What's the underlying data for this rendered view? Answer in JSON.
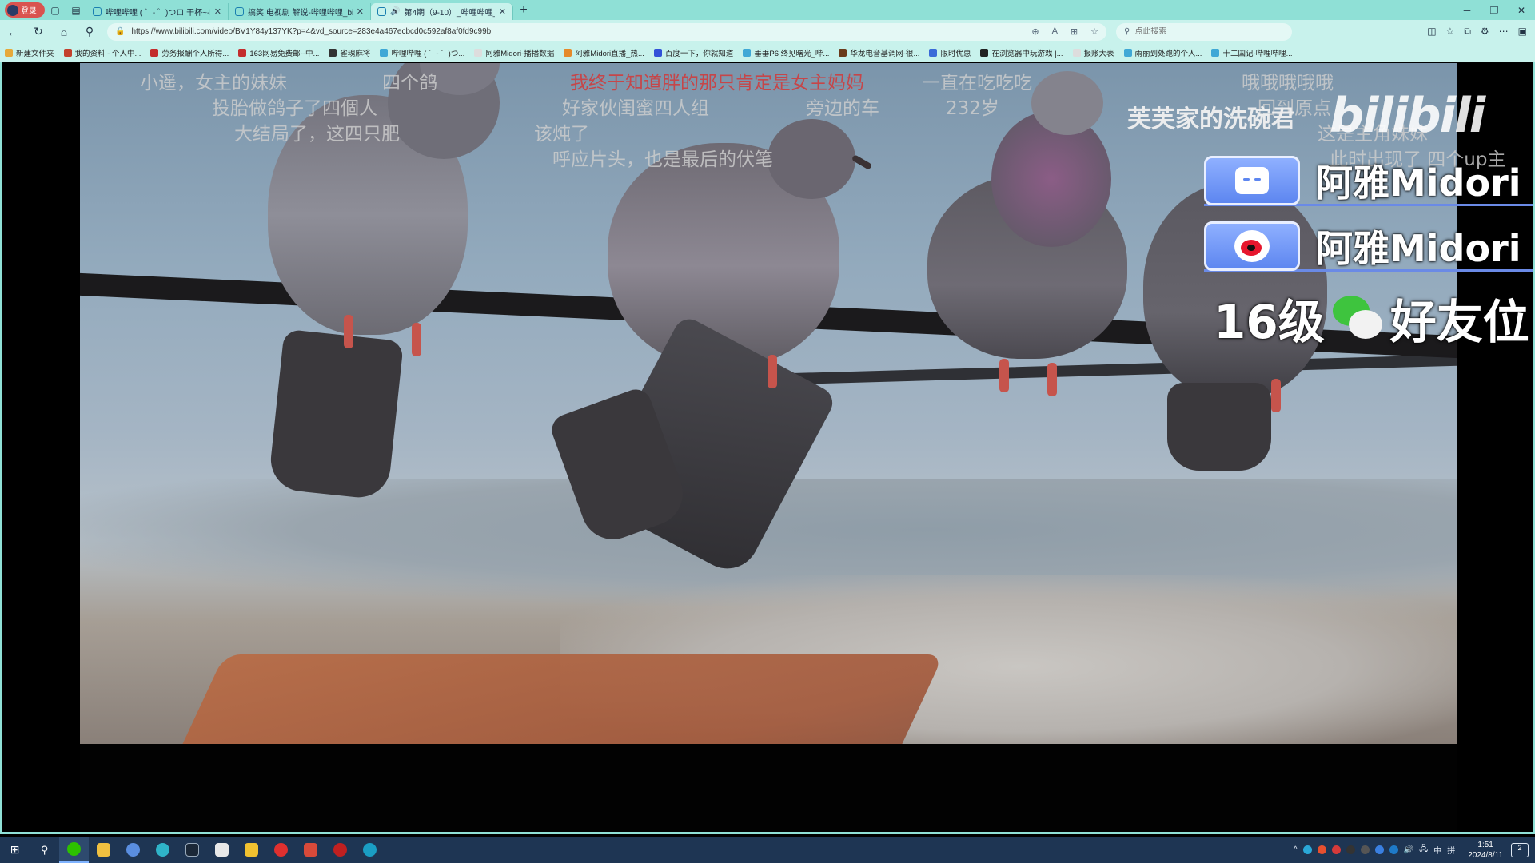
{
  "browser": {
    "profile_label": "登录",
    "tabs": [
      {
        "title": "哔哩哔哩 ( ゜- ゜)つロ 干杯~-bili"
      },
      {
        "title": "搞笑 电视剧 解说-哔哩哔哩_bilibili"
      },
      {
        "title": "第4期（9-10）_哔哩哔哩_bi"
      }
    ],
    "new_tab": "+",
    "url": "https://www.bilibili.com/video/BV1Y84y137YK?p=4&vd_source=283e4a467ecbcd0c592af8af0fd9c99b",
    "search_placeholder": "点此搜索",
    "bookmarks": [
      "新建文件夹",
      "我的资料 - 个人中...",
      "劳务报酬个人所得...",
      "163网易免费邮--中...",
      "雀魂麻将",
      "哔哩哔哩 ( ゜- ゜)つ...",
      "阿雅Midori-播播数据",
      "阿雅Midori直播_热...",
      "百度一下，你就知道",
      "垂垂P6 终见曙光_哔...",
      "华龙电音基调网-很...",
      "限时优惠",
      "在浏览器中玩游戏 |...",
      "报账大表",
      "雨丽到处跑的个人...",
      "十二国记-哔哩哔哩..."
    ]
  },
  "video": {
    "danmaku": [
      {
        "text": "小遥，女主的妹妹",
        "style": "gray"
      },
      {
        "text": "四个鸽",
        "style": "gray"
      },
      {
        "text": "我终于知道",
        "style": "red"
      },
      {
        "text": "胖的那只肯定是女主妈妈",
        "style": "red"
      },
      {
        "text": "一直在吃吃吃",
        "style": "gray"
      },
      {
        "text": "哦哦哦哦哦",
        "style": "gray"
      },
      {
        "text": "投胎做鸽子了四個人",
        "style": "gray"
      },
      {
        "text": "好家伙闺蜜四人组",
        "style": "gray"
      },
      {
        "text": "旁边的车",
        "style": "gray"
      },
      {
        "text": "232岁",
        "style": "gray"
      },
      {
        "text": "回到原点",
        "style": "gray"
      },
      {
        "text": "芙芙家的洗碗君",
        "style": "white"
      },
      {
        "text": "大结局了，这四只肥",
        "style": "gray"
      },
      {
        "text": "该炖了",
        "style": "gray"
      },
      {
        "text": "这是主角妹妹",
        "style": "gray"
      },
      {
        "text": "呼应片头，也是最后的伏笔",
        "style": "gray"
      },
      {
        "text": "此时出现了 四个up主",
        "style": "gray"
      }
    ],
    "overlay": {
      "bilibili_name": "阿雅Midori",
      "weibo_name": "阿雅Midori",
      "wechat_level": "16级",
      "wechat_text": "好友位",
      "watermark": "bilibili"
    }
  },
  "taskbar": {
    "apps": [
      "start",
      "search",
      "wechat",
      "files",
      "browser-1",
      "edge",
      "steam",
      "app-6",
      "app-7",
      "netease-music",
      "app-9",
      "app-10",
      "app-11"
    ],
    "tray_text": [
      "中",
      "拼"
    ],
    "time": "1:51",
    "date": "2024/8/11",
    "notification_count": "2"
  },
  "colors": {
    "chrome_tab": "#8fe0d6",
    "chrome_bar": "#c8f2ec",
    "taskbar": "#1e3553",
    "danmaku_red": "#d23737",
    "badge_blue": "#5d86f0"
  }
}
